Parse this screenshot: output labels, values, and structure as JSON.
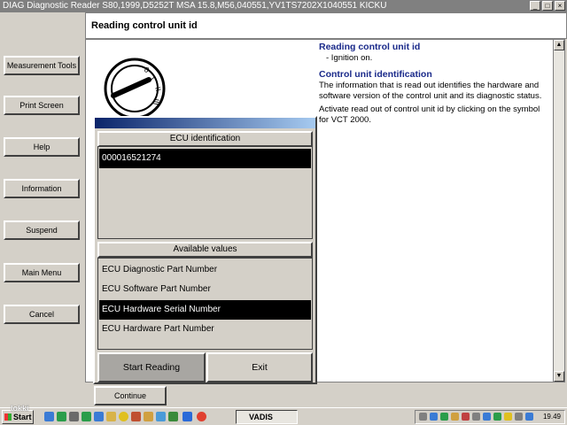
{
  "window": {
    "title": "DIAG Diagnostic Reader S80,1999,D5252T MSA 15.8,M56,040551,YV1TS7202X1040551 KICKU",
    "minimize_glyph": "_",
    "maximize_glyph": "□",
    "close_glyph": "×"
  },
  "sidebar": {
    "items": [
      {
        "label": "Measurement Tools"
      },
      {
        "label": "Print Screen"
      },
      {
        "label": "Help"
      },
      {
        "label": "Information"
      },
      {
        "label": "Suspend"
      },
      {
        "label": "Main Menu"
      },
      {
        "label": "Cancel"
      }
    ]
  },
  "header": {
    "title": "Reading control unit id"
  },
  "info": {
    "heading1": "Reading control unit id",
    "bullet": "- Ignition on.",
    "heading2": "Control unit identification",
    "para1": "The information that is read out identifies the hardware and software version of the control unit and its diagnostic status.",
    "para2": "Activate read out of control unit id by clicking on the symbol for VCT 2000."
  },
  "dialog": {
    "ecu_header": "ECU identification",
    "ecu_value": "000016521274",
    "values_header": "Available values",
    "values": [
      {
        "label": "ECU Diagnostic Part Number"
      },
      {
        "label": "ECU Software Part Number"
      },
      {
        "label": "ECU Hardware Serial Number",
        "selected": true
      },
      {
        "label": "ECU Hardware Part Number"
      }
    ],
    "start_label": "Start Reading",
    "exit_label": "Exit"
  },
  "continue_label": "Continue",
  "taskbar": {
    "start_label": "Start",
    "task_label": "VADIS",
    "clock": "19.49"
  },
  "watermark": "lokki",
  "colors": {
    "heading": "#1a2a8a",
    "titlebar": "#808080",
    "dialog_title_start": "#0a246a",
    "selection": "#000000"
  },
  "icons": {
    "ignition": "ignition-switch-icon",
    "scroll_up": "arrow-up-icon",
    "scroll_down": "arrow-down-icon"
  }
}
